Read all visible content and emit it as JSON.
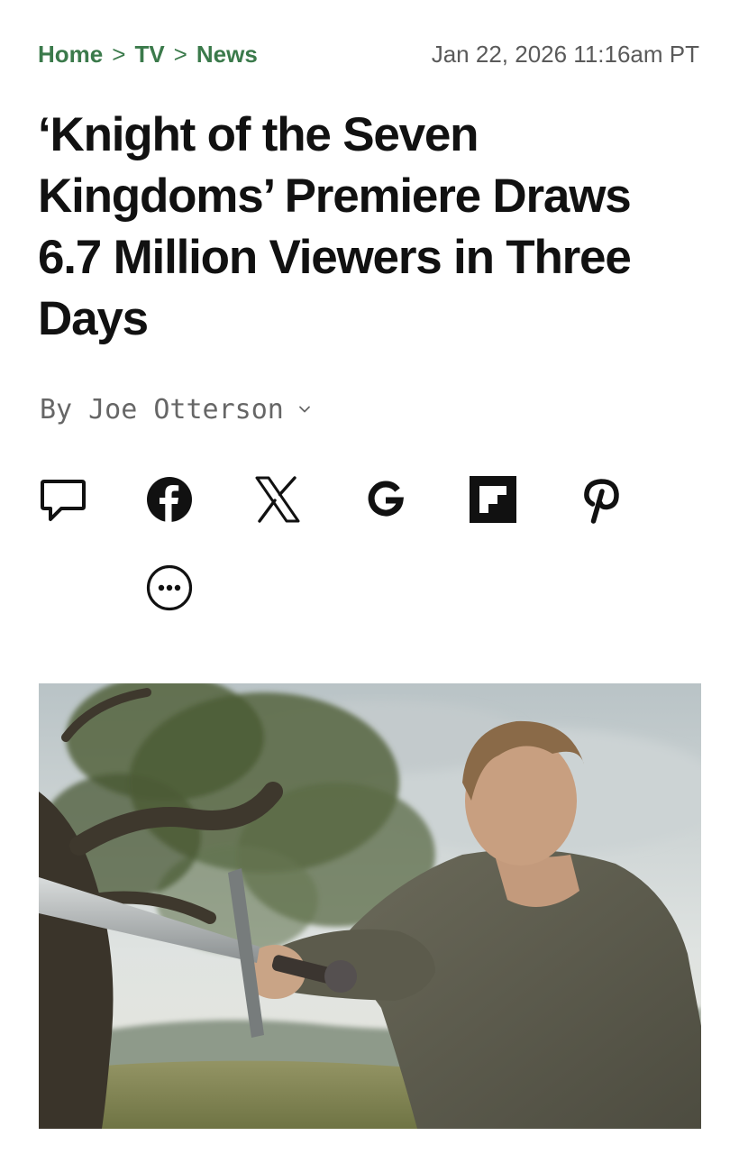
{
  "breadcrumb": {
    "items": [
      "Home",
      "TV",
      "News"
    ],
    "separator": ">"
  },
  "article": {
    "date": "Jan 22, 2026 11:16am PT",
    "headline": "‘Knight of the Seven Kingdoms’ Premiere Draws 6.7 Million Viewers in Three Days",
    "byline_prefix": "By",
    "author": "Joe Otterson"
  },
  "share": {
    "icons": [
      "comment-icon",
      "facebook-icon",
      "x-icon",
      "google-icon",
      "flipboard-icon",
      "pinterest-icon",
      "more-icon"
    ]
  },
  "colors": {
    "breadcrumb": "#3b7a4b",
    "text": "#111111",
    "muted": "#666666",
    "date": "#5a5a5a"
  }
}
